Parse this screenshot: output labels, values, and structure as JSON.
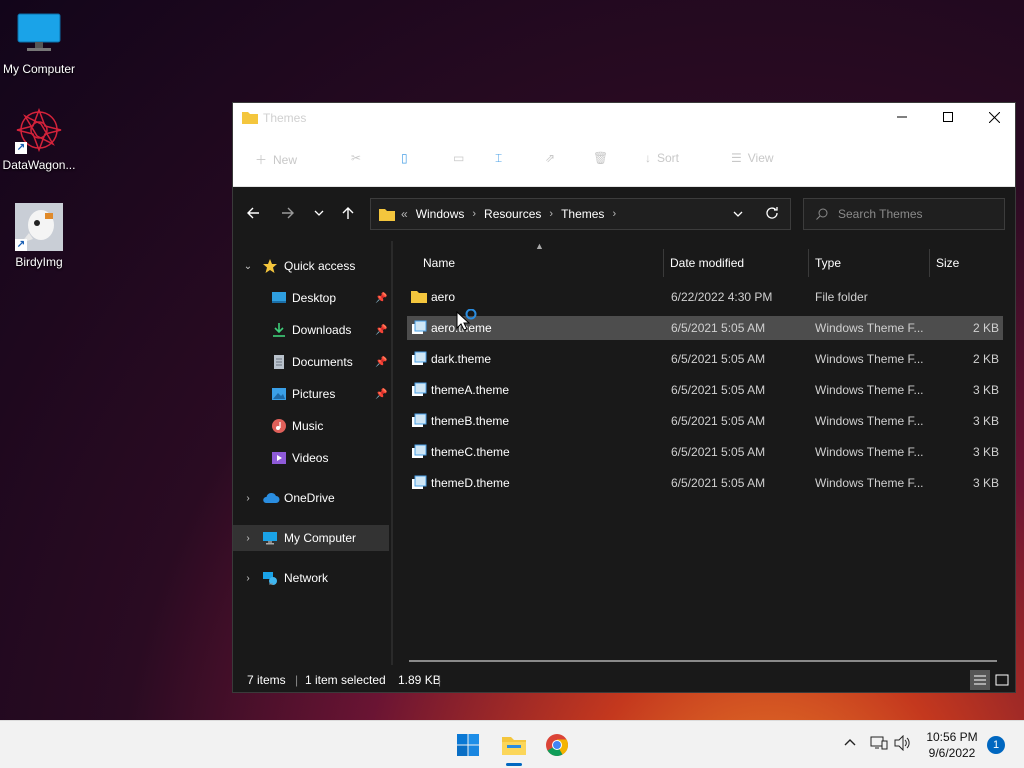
{
  "desktop": {
    "icons": [
      {
        "label": "My Computer"
      },
      {
        "label": "DataWagon..."
      },
      {
        "label": "BirdyImg"
      }
    ]
  },
  "window": {
    "title": "Themes",
    "toolbar": {
      "new_label": "New",
      "sort_label": "Sort",
      "view_label": "View"
    },
    "address": {
      "overflow": "«",
      "crumbs": [
        "Windows",
        "Resources",
        "Themes"
      ]
    },
    "search": {
      "placeholder": "Search Themes"
    },
    "nav": {
      "quick_access": "Quick access",
      "items": [
        {
          "label": "Desktop",
          "pinned": true
        },
        {
          "label": "Downloads",
          "pinned": true
        },
        {
          "label": "Documents",
          "pinned": true
        },
        {
          "label": "Pictures",
          "pinned": true
        },
        {
          "label": "Music",
          "pinned": false
        },
        {
          "label": "Videos",
          "pinned": false
        }
      ],
      "onedrive": "OneDrive",
      "my_computer": "My Computer",
      "network": "Network"
    },
    "columns": {
      "name": "Name",
      "date": "Date modified",
      "type": "Type",
      "size": "Size"
    },
    "files": [
      {
        "name": "aero",
        "date": "6/22/2022 4:30 PM",
        "type": "File folder",
        "size": "",
        "kind": "folder"
      },
      {
        "name": "aero.theme",
        "date": "6/5/2021 5:05 AM",
        "type": "Windows Theme F...",
        "size": "2 KB",
        "kind": "theme",
        "selected": true
      },
      {
        "name": "dark.theme",
        "date": "6/5/2021 5:05 AM",
        "type": "Windows Theme F...",
        "size": "2 KB",
        "kind": "theme"
      },
      {
        "name": "themeA.theme",
        "date": "6/5/2021 5:05 AM",
        "type": "Windows Theme F...",
        "size": "3 KB",
        "kind": "theme"
      },
      {
        "name": "themeB.theme",
        "date": "6/5/2021 5:05 AM",
        "type": "Windows Theme F...",
        "size": "3 KB",
        "kind": "theme"
      },
      {
        "name": "themeC.theme",
        "date": "6/5/2021 5:05 AM",
        "type": "Windows Theme F...",
        "size": "3 KB",
        "kind": "theme"
      },
      {
        "name": "themeD.theme",
        "date": "6/5/2021 5:05 AM",
        "type": "Windows Theme F...",
        "size": "3 KB",
        "kind": "theme"
      }
    ],
    "status": {
      "item_count": "7 items",
      "selection": "1 item selected",
      "selection_size": "1.89 KB"
    }
  },
  "taskbar": {
    "clock_time": "10:56 PM",
    "clock_date": "9/6/2022",
    "notification_count": "1"
  },
  "colors": {
    "accent": "#0067c0",
    "selection": "#4d4d4d",
    "folder": "#f4c63d"
  }
}
